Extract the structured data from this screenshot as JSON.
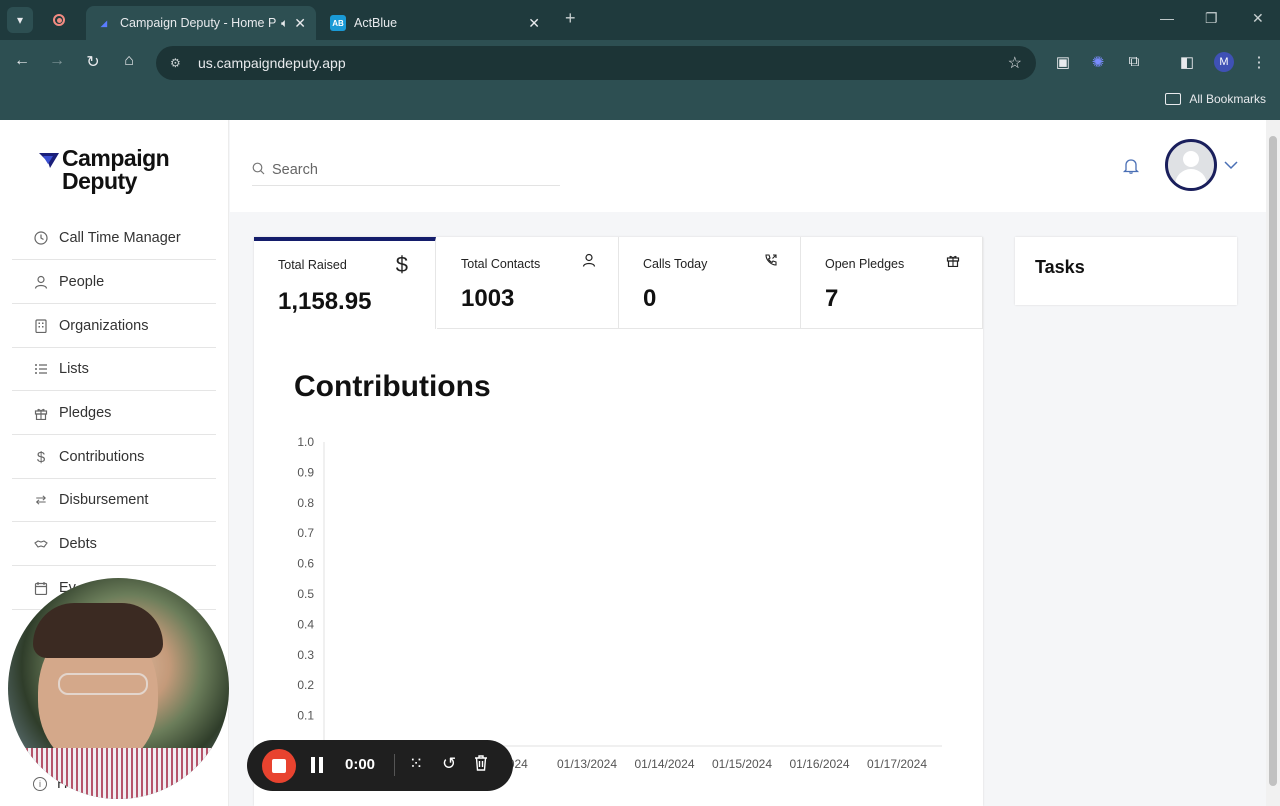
{
  "browser": {
    "tabs": [
      {
        "title": "Campaign Deputy - Home P",
        "active": true
      },
      {
        "title": "ActBlue",
        "active": false,
        "favicon_text": "AB"
      }
    ],
    "url": "us.campaigndeputy.app",
    "bookmarks_label": "All Bookmarks",
    "profile_initial": "M"
  },
  "app": {
    "logo_line1": "Campaign",
    "logo_line2": "Deputy",
    "search_placeholder": "Search",
    "accent_color": "#141d6b",
    "sidebar": [
      {
        "label": "Call Time Manager",
        "icon": "clock-icon"
      },
      {
        "label": "People",
        "icon": "person-icon"
      },
      {
        "label": "Organizations",
        "icon": "building-icon"
      },
      {
        "label": "Lists",
        "icon": "list-icon"
      },
      {
        "label": "Pledges",
        "icon": "gift-icon"
      },
      {
        "label": "Contributions",
        "icon": "dollar-icon"
      },
      {
        "label": "Disbursement",
        "icon": "transfer-icon"
      },
      {
        "label": "Debts",
        "icon": "handshake-icon"
      },
      {
        "label": "Ev",
        "icon": "calendar-icon"
      }
    ],
    "help_label": "He",
    "stats": [
      {
        "label": "Total Raised",
        "value": "1,158.95",
        "icon": "dollar-icon"
      },
      {
        "label": "Total Contacts",
        "value": "1003",
        "icon": "person-icon"
      },
      {
        "label": "Calls Today",
        "value": "0",
        "icon": "phone-icon"
      },
      {
        "label": "Open Pledges",
        "value": "7",
        "icon": "gift-icon"
      }
    ],
    "chart_title": "Contributions",
    "tasks_title": "Tasks"
  },
  "chart_data": {
    "type": "line",
    "title": "Contributions",
    "y_ticks": [
      "1.0",
      "0.9",
      "0.8",
      "0.7",
      "0.6",
      "0.5",
      "0.4",
      "0.3",
      "0.2",
      "0.1"
    ],
    "x_labels": [
      "2/2024",
      "01/13/2024",
      "01/14/2024",
      "01/15/2024",
      "01/16/2024",
      "01/17/2024"
    ],
    "ylim": [
      0,
      1.0
    ],
    "series": []
  },
  "recorder": {
    "time": "0:00"
  }
}
